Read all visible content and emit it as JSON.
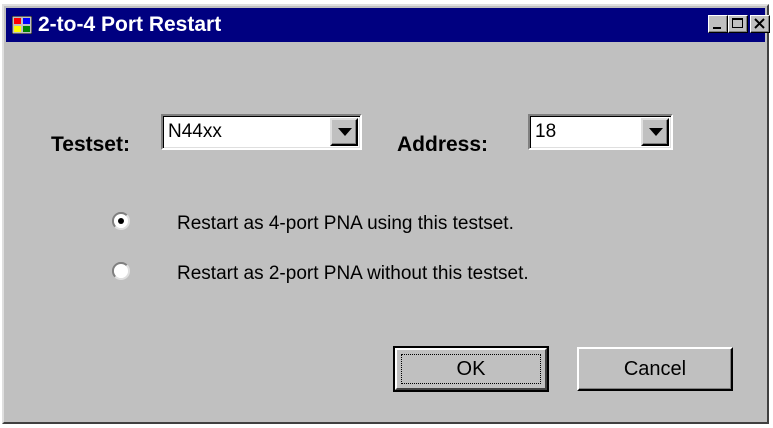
{
  "window": {
    "title": "2-to-4 Port Restart",
    "icon": "app-window-icon",
    "controls": [
      "minimize-icon",
      "maximize-icon",
      "close-icon"
    ]
  },
  "testset": {
    "label": "Testset:",
    "value": "N44xx"
  },
  "address": {
    "label": "Address:",
    "value": "18"
  },
  "options": [
    {
      "label": "Restart as 4-port PNA using this testset.",
      "selected": true
    },
    {
      "label": "Restart as 2-port PNA without this testset.",
      "selected": false
    }
  ],
  "buttons": {
    "ok": "OK",
    "cancel": "Cancel"
  },
  "colors": {
    "titlebar": "#000080",
    "face": "#c0c0c0"
  }
}
